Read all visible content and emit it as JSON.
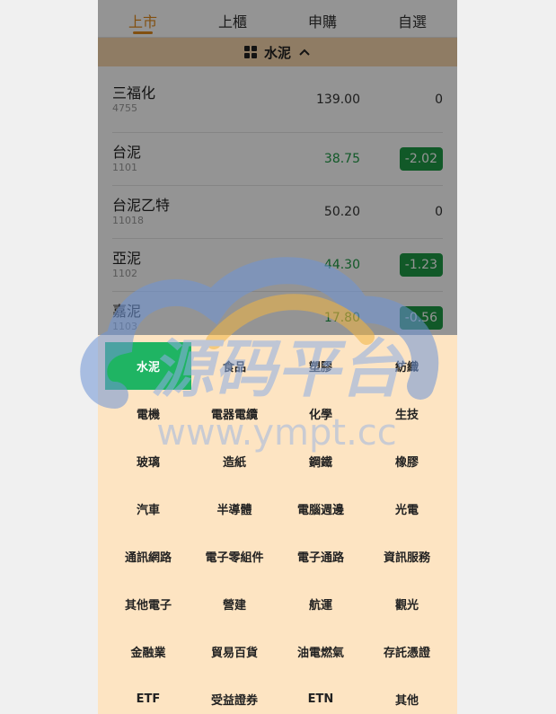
{
  "tabs": [
    {
      "label": "上市",
      "active": true
    },
    {
      "label": "上櫃",
      "active": false
    },
    {
      "label": "申購",
      "active": false
    },
    {
      "label": "自選",
      "active": false
    }
  ],
  "category_header": {
    "label": "水泥",
    "icon": "grid-icon",
    "toggle_icon": "chevron-up-icon"
  },
  "stocks": [
    {
      "name": "三福化",
      "code": "4755",
      "price": "139.00",
      "change": "0",
      "trend": "flat"
    },
    {
      "name": "台泥",
      "code": "1101",
      "price": "38.75",
      "change": "-2.02",
      "trend": "down"
    },
    {
      "name": "台泥乙特",
      "code": "11018",
      "price": "50.20",
      "change": "0",
      "trend": "flat"
    },
    {
      "name": "亞泥",
      "code": "1102",
      "price": "44.30",
      "change": "-1.23",
      "trend": "down"
    },
    {
      "name": "嘉泥",
      "code": "1103",
      "price": "17.80",
      "change": "-0.56",
      "trend": "down"
    }
  ],
  "categories": [
    "水泥",
    "食品",
    "塑膠",
    "紡織",
    "電機",
    "電器電纜",
    "化學",
    "生技",
    "玻璃",
    "造紙",
    "鋼鐵",
    "橡膠",
    "汽車",
    "半導體",
    "電腦週邊",
    "光電",
    "通訊網路",
    "電子零組件",
    "電子通路",
    "資訊服務",
    "其他電子",
    "營建",
    "航運",
    "觀光",
    "金融業",
    "貿易百貨",
    "油電燃氣",
    "存託憑證",
    "ETF",
    "受益證券",
    "ETN",
    "其他"
  ],
  "active_category_index": 0,
  "watermark": {
    "cn": "源码平台",
    "url": "www.ympt.cc"
  },
  "colors": {
    "accent": "#e08a1e",
    "down": "#1e9a46",
    "active_cat": "#1fb463",
    "panel_bg": "#fde4c2"
  }
}
